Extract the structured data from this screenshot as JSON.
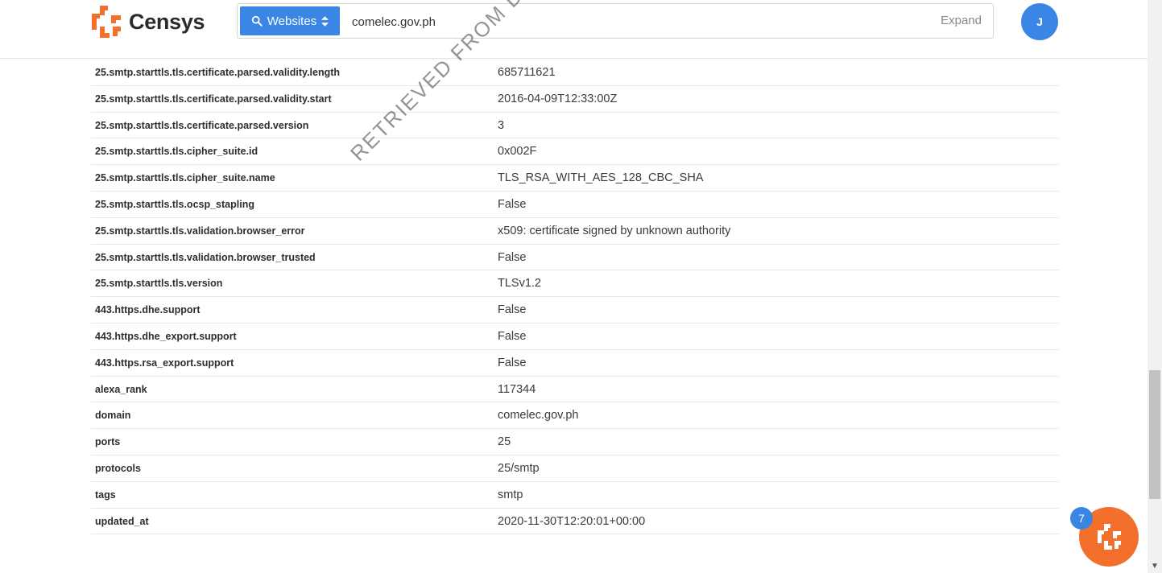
{
  "brand": {
    "name": "Censys",
    "logo_color": "#f36f2c"
  },
  "search": {
    "type_label": "Websites",
    "value": "comelec.gov.ph",
    "expand_label": "Expand",
    "accent": "#3a86e4"
  },
  "user": {
    "initial": "J"
  },
  "watermark": "RETRIEVED FROM DEMOCRACY",
  "rows": [
    {
      "key": "25.smtp.starttls.tls.certificate.parsed.validity.length",
      "value": "685711621"
    },
    {
      "key": "25.smtp.starttls.tls.certificate.parsed.validity.start",
      "value": "2016-04-09T12:33:00Z"
    },
    {
      "key": "25.smtp.starttls.tls.certificate.parsed.version",
      "value": "3"
    },
    {
      "key": "25.smtp.starttls.tls.cipher_suite.id",
      "value": "0x002F"
    },
    {
      "key": "25.smtp.starttls.tls.cipher_suite.name",
      "value": "TLS_RSA_WITH_AES_128_CBC_SHA"
    },
    {
      "key": "25.smtp.starttls.tls.ocsp_stapling",
      "value": "False"
    },
    {
      "key": "25.smtp.starttls.tls.validation.browser_error",
      "value": "x509: certificate signed by unknown authority"
    },
    {
      "key": "25.smtp.starttls.tls.validation.browser_trusted",
      "value": "False"
    },
    {
      "key": "25.smtp.starttls.tls.version",
      "value": "TLSv1.2"
    },
    {
      "key": "443.https.dhe.support",
      "value": "False"
    },
    {
      "key": "443.https.dhe_export.support",
      "value": "False"
    },
    {
      "key": "443.https.rsa_export.support",
      "value": "False"
    },
    {
      "key": "alexa_rank",
      "value": "117344"
    },
    {
      "key": "domain",
      "value": "comelec.gov.ph"
    },
    {
      "key": "ports",
      "value": "25"
    },
    {
      "key": "protocols",
      "value": "25/smtp"
    },
    {
      "key": "tags",
      "value": "smtp"
    },
    {
      "key": "updated_at",
      "value": "2020-11-30T12:20:01+00:00"
    }
  ],
  "chat": {
    "badge_count": "7",
    "color": "#f36f2c"
  },
  "icons": {
    "search": "search-icon",
    "sort": "sort-icon",
    "chat": "chat-icon",
    "scroll_down": "chevron-down-icon"
  }
}
